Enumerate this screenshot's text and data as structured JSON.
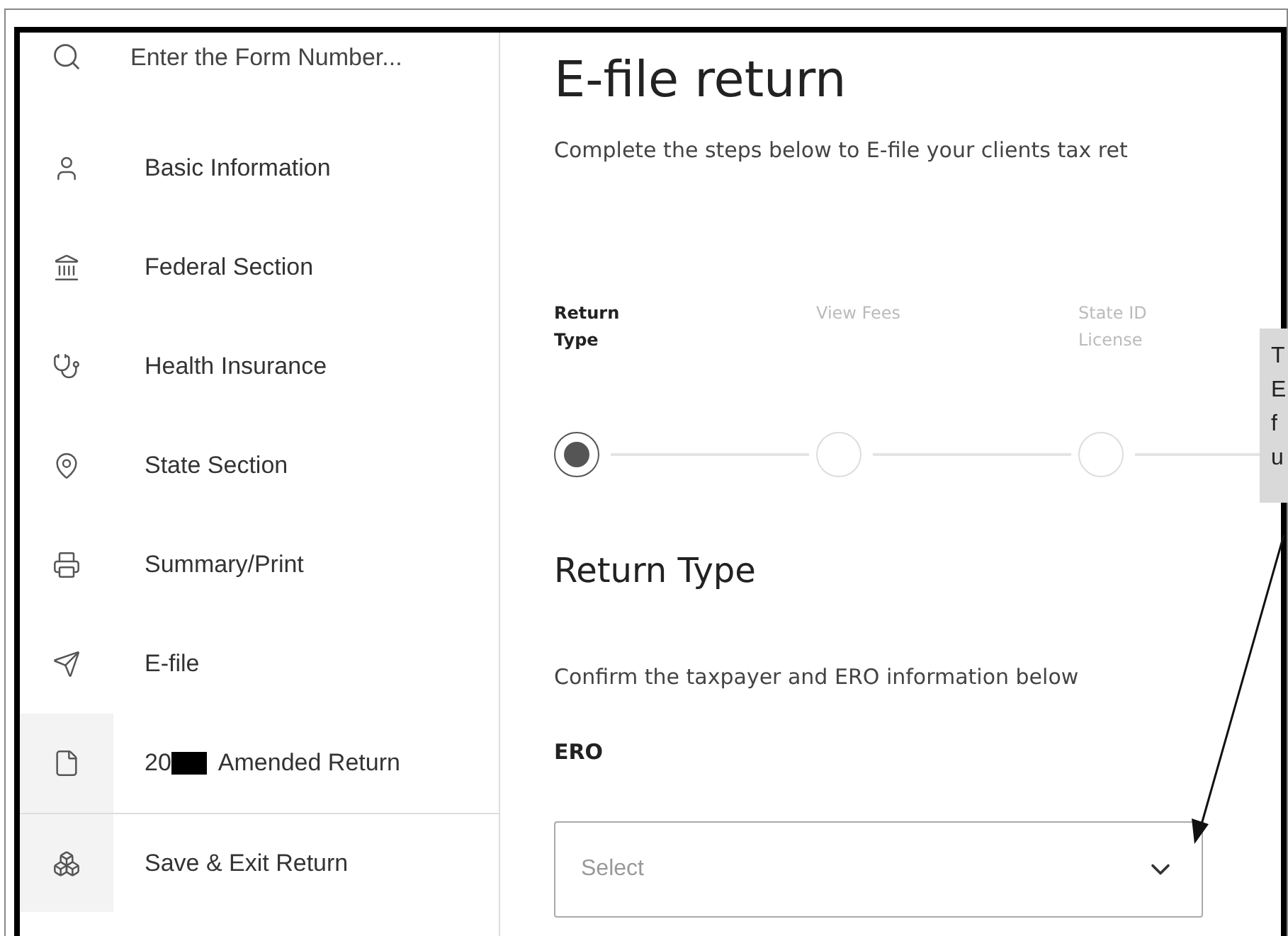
{
  "sidebar": {
    "search": {
      "placeholder": "Enter the Form Number..."
    },
    "items": [
      {
        "label": "Basic Information",
        "selected": false
      },
      {
        "label": "Federal Section",
        "selected": false
      },
      {
        "label": "Health Insurance",
        "selected": false
      },
      {
        "label": "State Section",
        "selected": false
      },
      {
        "label": "Summary/Print",
        "selected": false
      },
      {
        "label": "E-file",
        "selected": false
      },
      {
        "label_prefix": "20",
        "redacted": true,
        "label": "Amended Return",
        "selected": false
      },
      {
        "label": "Save & Exit Return",
        "selected": false
      }
    ]
  },
  "main": {
    "title": "E-file return",
    "subtitle": "Complete the steps below to E-file your clients tax ret",
    "steps": [
      {
        "label": "Return Type",
        "selected": true
      },
      {
        "label": "View Fees",
        "selected": false
      },
      {
        "label": "State ID License",
        "selected": false
      }
    ],
    "section_title": "Return Type",
    "section_text": "Confirm the taxpayer and ERO information below",
    "ero": {
      "label": "ERO",
      "placeholder": "Select"
    }
  },
  "callout": {
    "lines": [
      "T",
      "E",
      "f",
      "u"
    ]
  }
}
